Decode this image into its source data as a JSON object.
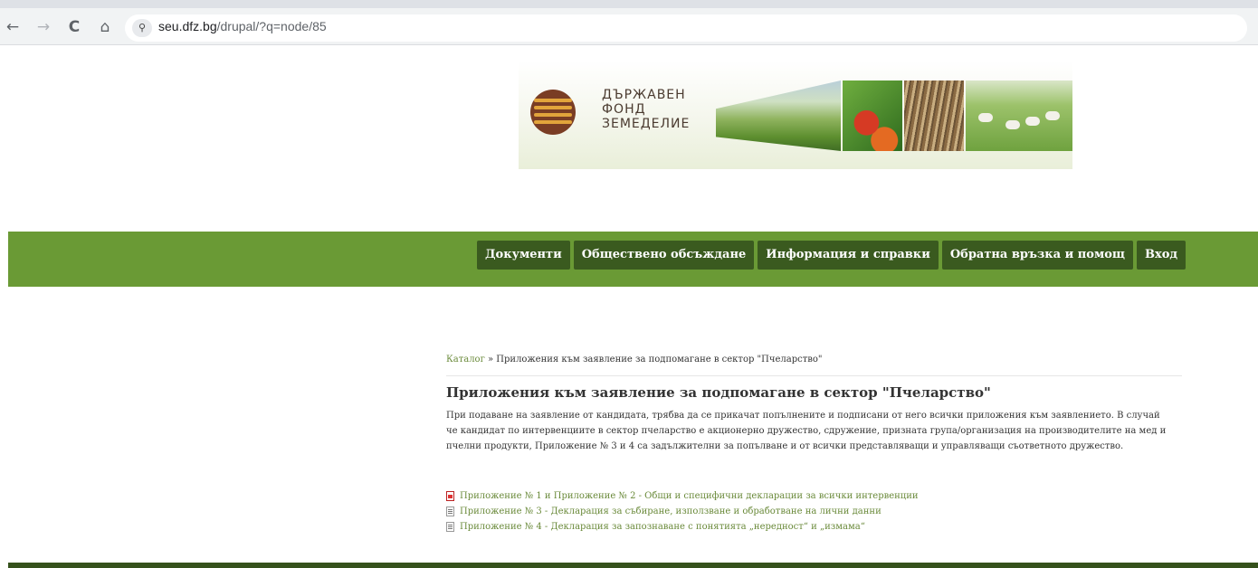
{
  "browser": {
    "back_icon": "←",
    "forward_icon": "→",
    "reload_icon": "C",
    "home_icon": "⌂",
    "site_info_icon": "⚲",
    "url_host": "seu.dfz.bg",
    "url_path": "/drupal/?q=node/85"
  },
  "banner": {
    "logo_text": "ДЪРЖАВЕН\nФОНД\nЗЕМЕДЕЛИЕ"
  },
  "menu": {
    "items": [
      {
        "label": "Документи"
      },
      {
        "label": "Обществено обсъждане"
      },
      {
        "label": "Информация и справки"
      },
      {
        "label": "Обратна връзка и помощ"
      },
      {
        "label": "Вход"
      }
    ]
  },
  "breadcrumb": {
    "home": "Каталог",
    "separator": " » ",
    "current": "Приложения към заявление за подпомагане в сектор \"Пчеларство\""
  },
  "page": {
    "title": "Приложения към заявление за подпомагане в сектор \"Пчеларство\"",
    "body": "При подаване на заявление от кандидата, трябва да се прикачат попълнените и подписани от него всички приложения към заявлението. В случай че кандидат по интервенциите в сектор пчеларство е акционерно дружество, сдружение, призната група/организация на производителите на мед и пчелни продукти, Приложение № 3 и 4 са задължителни за попълване и от всички представляващи и управляващи съответното дружество."
  },
  "documents": [
    {
      "type": "pdf",
      "icon": "pdf-file-icon",
      "label": "Приложение № 1 и Приложение № 2 - Общи и специфични декларации за всички интервенции"
    },
    {
      "type": "doc",
      "icon": "document-file-icon",
      "label": "Приложение № 3 - Декларация за събиране, използване и обработване на лични данни"
    },
    {
      "type": "doc",
      "icon": "document-file-icon",
      "label": "Приложение № 4 - Декларация за запознаване с понятията „нередност“ и „измама“"
    }
  ],
  "colors": {
    "nav_band": "#6a9a35",
    "menu_button": "#3a5a1f",
    "link": "#6a8a3a",
    "footer": "#35511c"
  }
}
